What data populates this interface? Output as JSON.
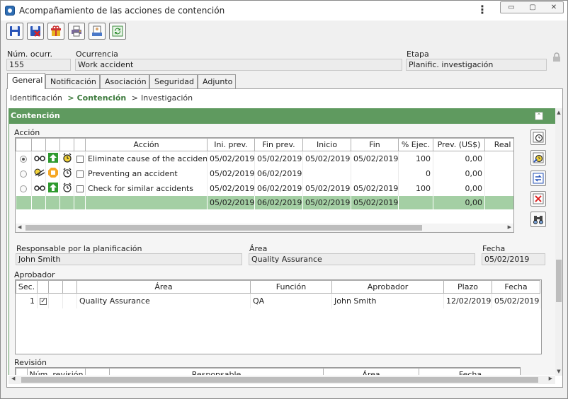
{
  "window": {
    "title": "Acompañamiento de las acciones de contención",
    "controls": {
      "minimize": "▭",
      "maximize": "▢",
      "close": "✕"
    }
  },
  "toolbar": {
    "buttons": [
      "save-icon",
      "save-close-icon",
      "gift-icon",
      "printer-icon",
      "report-icon",
      "refresh-icon"
    ]
  },
  "header": {
    "num_label": "Núm. ocurr.",
    "num_value": "155",
    "ocurrencia_label": "Ocurrencia",
    "ocurrencia_value": "Work accident",
    "etapa_label": "Etapa",
    "etapa_value": "Planific. investigación"
  },
  "tabs": [
    "General",
    "Notificación",
    "Asociación",
    "Seguridad",
    "Adjunto"
  ],
  "breadcrumb": {
    "items": [
      "Identificación",
      "Contención",
      "Investigación"
    ],
    "sep": ">"
  },
  "section_title": "Contención",
  "accion": {
    "label": "Acción",
    "columns": [
      "Acción",
      "Ini. prev.",
      "Fin prev.",
      "Inicio",
      "Fin",
      "% Ejec.",
      "Prev. (US$)",
      "Real ("
    ],
    "rows": [
      {
        "selected": true,
        "name": "Eliminate cause of the accident",
        "ini_prev": "05/02/2019",
        "fin_prev": "05/02/2019",
        "inicio": "05/02/2019",
        "fin": "05/02/2019",
        "ejec": "100",
        "prev": "0,00"
      },
      {
        "selected": false,
        "name": "Preventing an accident",
        "ini_prev": "05/02/2019",
        "fin_prev": "06/02/2019",
        "inicio": "",
        "fin": "",
        "ejec": "0",
        "prev": "0,00"
      },
      {
        "selected": false,
        "name": "Check for similar accidents",
        "ini_prev": "05/02/2019",
        "fin_prev": "06/02/2019",
        "inicio": "05/02/2019",
        "fin": "05/02/2019",
        "ejec": "100",
        "prev": "0,00"
      }
    ],
    "summary": {
      "ini_prev": "05/02/2019",
      "fin_prev": "06/02/2019",
      "inicio": "05/02/2019",
      "fin": "05/02/2019",
      "prev": "0,00"
    }
  },
  "responsable": {
    "label": "Responsable por la planificación",
    "value": "John Smith",
    "area_label": "Área",
    "area_value": "Quality Assurance",
    "fecha_label": "Fecha",
    "fecha_value": "05/02/2019"
  },
  "aprobador": {
    "label": "Aprobador",
    "columns": [
      "Sec.",
      "Área",
      "Función",
      "Aprobador",
      "Plazo",
      "Fecha"
    ],
    "rows": [
      {
        "sec": "1",
        "checked": true,
        "area": "Quality Assurance",
        "funcion": "QA",
        "aprobador": "John Smith",
        "plazo": "12/02/2019",
        "fecha": "05/02/2019"
      }
    ]
  },
  "revision": {
    "label": "Revisión",
    "columns": [
      "Núm. revisión",
      "Responsable",
      "Área",
      "Fecha"
    ]
  }
}
